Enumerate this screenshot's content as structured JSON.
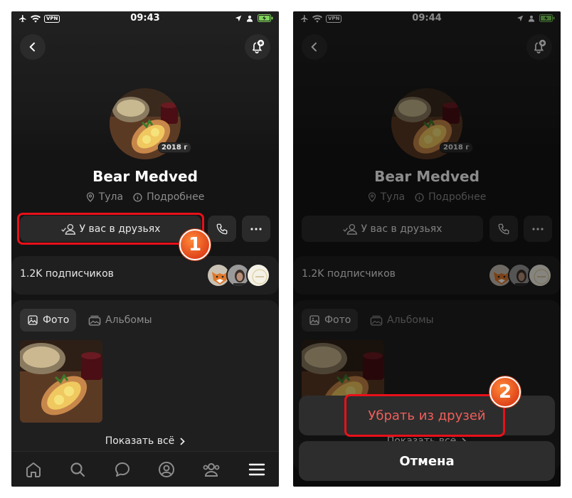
{
  "left": {
    "status": {
      "time": "09:43",
      "vpn": "VPN"
    },
    "profile": {
      "name": "Bear Medved",
      "year_badge": "2018 г",
      "city": "Тула",
      "more": "Подробнее"
    },
    "friends_button": "У вас в друзьях",
    "subscribers": "1.2K подписчиков",
    "tabs": {
      "photo": "Фото",
      "albums": "Альбомы"
    },
    "show_all": "Показать всё",
    "step": "1"
  },
  "right": {
    "status": {
      "time": "09:44",
      "vpn": "VPN"
    },
    "profile": {
      "name": "Bear Medved",
      "year_badge": "2018 г",
      "city": "Тула",
      "more": "Подробнее"
    },
    "friends_button": "У вас в друзьях",
    "subscribers": "1.2K подписчиков",
    "tabs": {
      "photo": "Фото",
      "albums": "Альбомы"
    },
    "show_all": "Показать всё",
    "sheet": {
      "remove": "Убрать из друзей",
      "cancel": "Отмена"
    },
    "step": "2"
  },
  "colors": {
    "background": "#141414",
    "card": "#1f1f1f",
    "button": "#2a2a2a",
    "danger": "#ee5f5b",
    "highlight": "#e8101a",
    "badge": "#e0451a"
  },
  "icons": [
    "airplane-icon",
    "wifi-icon",
    "location-arrow-icon",
    "person-icon",
    "battery-icon",
    "back-arrow-icon",
    "bell-plus-icon",
    "location-pin-icon",
    "info-icon",
    "friend-check-icon",
    "phone-icon",
    "ellipsis-icon",
    "image-icon",
    "albums-icon",
    "chevron-right-icon",
    "home-icon",
    "search-icon",
    "messages-icon",
    "profile-icon",
    "friends-icon",
    "menu-icon"
  ]
}
